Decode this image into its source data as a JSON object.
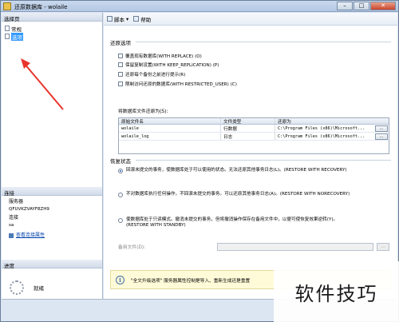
{
  "window": {
    "title": "还原数据库 - wolaile"
  },
  "left": {
    "select_page_header": "选择页",
    "nav": [
      {
        "label": "常规"
      },
      {
        "label": "选项"
      }
    ],
    "connection_header": "连接",
    "server_label": "服务器",
    "server_value": "QFUVKZVAYF8ZH9",
    "conn_label": "连接",
    "conn_value": "sa",
    "view_props_link": "查看连接属性",
    "progress_header": "进度",
    "progress_status": "就绪"
  },
  "toolbar": {
    "script_label": "脚本",
    "help_label": "帮助"
  },
  "restore_options": {
    "title": "还原选项",
    "checkboxes": [
      "覆盖现有数据库(WITH REPLACE) (O)",
      "保留复制设置(WITH KEEP_REPLICATION) (P)",
      "还原每个备份之前进行提示(R)",
      "限制访问还原的数据库(WITH RESTRICTED_USER) (C)"
    ],
    "restore_as_label": "将数据库文件还原为(S):",
    "columns": [
      "原始文件名",
      "文件类型",
      "还原为"
    ],
    "rows": [
      {
        "name": "wolaile",
        "type": "行数据",
        "path": "C:\\Program Files (x86)\\Microsoft..."
      },
      {
        "name": "wolaile_log",
        "type": "日志",
        "path": "C:\\Program Files (x86)\\Microsoft..."
      }
    ],
    "browse_label": "..."
  },
  "recovery": {
    "title": "恢复状态",
    "options": [
      "回滚未提交的事务，使数据库处于可以使用的状态。无法还原其他事务日志(L)。(RESTORE WITH RECOVERY)",
      "不对数据库执行任何操作，不回滚未提交的事务。可以还原其他事务日志(A)。(RESTORE WITH NORECOVERY)",
      "使数据库处于只读模式。撤消未提交的事务，但将撤消操作保存在备用文件中，以便可使恢复效果逆转(Y)。",
      "(RESTORE WITH STANDBY)"
    ],
    "standby_label": "备用文件(D):",
    "standby_browse": "..."
  },
  "info": {
    "text": "\"全文升级选项\" 服务器属性控制是导入、重新生成还是重置"
  },
  "watermark": "软件技巧"
}
